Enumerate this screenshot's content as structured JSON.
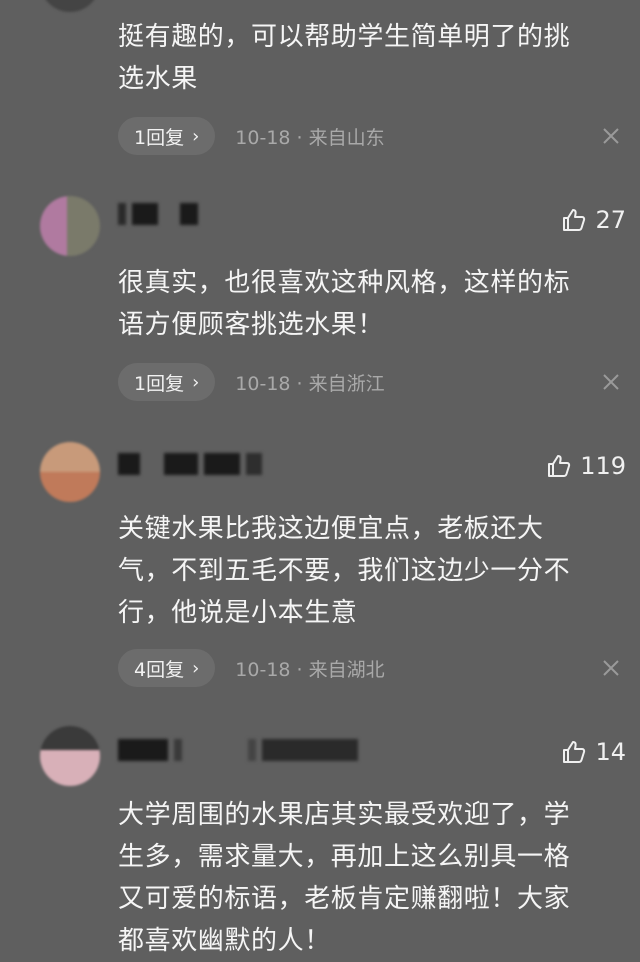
{
  "comments": [
    {
      "text_lines": [
        "挺有趣的，可以帮助学生简单明了的挑",
        "选水果"
      ],
      "reply_label": "1回复",
      "meta": "10-18 · 来自山东"
    },
    {
      "likes": "27",
      "text_lines": [
        "很真实，也很喜欢这种风格，这样的标",
        "语方便顾客挑选水果！"
      ],
      "reply_label": "1回复",
      "meta": "10-18 · 来自浙江"
    },
    {
      "likes": "119",
      "text_lines": [
        "关键水果比我这边便宜点，老板还大",
        "气，不到五毛不要，我们这边少一分不",
        "行，他说是小本生意"
      ],
      "reply_label": "4回复",
      "meta": "10-18 · 来自湖北"
    },
    {
      "likes": "14",
      "text_lines": [
        "大学周围的水果店其实最受欢迎了，学",
        "生多，需求量大，再加上这么别具一格",
        "又可爱的标语，老板肯定赚翻啦！大家",
        "都喜欢幽默的人！"
      ]
    }
  ],
  "icons": {
    "like": "thumbs-up-icon",
    "chevron": "chevron-right-icon",
    "dismiss": "close-icon"
  },
  "colors": {
    "background": "#5f5f5f",
    "text": "#f5f5f5",
    "meta": "#a9a9a9",
    "pill": "#6c6c6c"
  }
}
